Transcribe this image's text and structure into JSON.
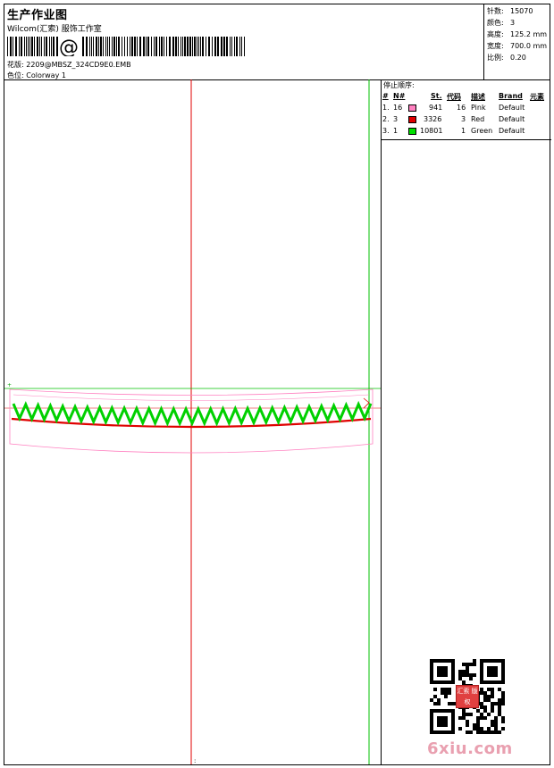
{
  "header": {
    "title": "生产作业图",
    "company": "Wilcom(汇索) 服饰工作室",
    "design_label": "花版:",
    "design_name": "2209@MBSZ_324CD9E0.EMB",
    "colorway_label": "色位:",
    "colorway_name": "Colorway 1"
  },
  "stats": [
    {
      "label": "针数:",
      "value": "15070"
    },
    {
      "label": "颜色:",
      "value": "3"
    },
    {
      "label": "高度:",
      "value": "125.2 mm"
    },
    {
      "label": "宽度:",
      "value": "700.0 mm"
    },
    {
      "label": "比例:",
      "value": "0.20"
    }
  ],
  "legend": {
    "title": "停止顺序:",
    "headers": [
      "#",
      "N#",
      "St.",
      "代码",
      "描述",
      "Brand",
      "元素"
    ],
    "rows": [
      {
        "index": "1.",
        "n": "16",
        "color": "#ff80c0",
        "stitches": "941",
        "code": "16",
        "desc": "Pink",
        "brand": "Default"
      },
      {
        "index": "2.",
        "n": "3",
        "color": "#e00000",
        "stitches": "3326",
        "code": "3",
        "desc": "Red",
        "brand": "Default"
      },
      {
        "index": "3.",
        "n": "1",
        "color": "#00e000",
        "stitches": "10801",
        "code": "1",
        "desc": "Green",
        "brand": "Default"
      }
    ]
  },
  "canvas_marks": {
    "bottom_mark": ":"
  },
  "watermark": {
    "text": "6xiu.com",
    "stamp_text": "汇索 版权"
  }
}
